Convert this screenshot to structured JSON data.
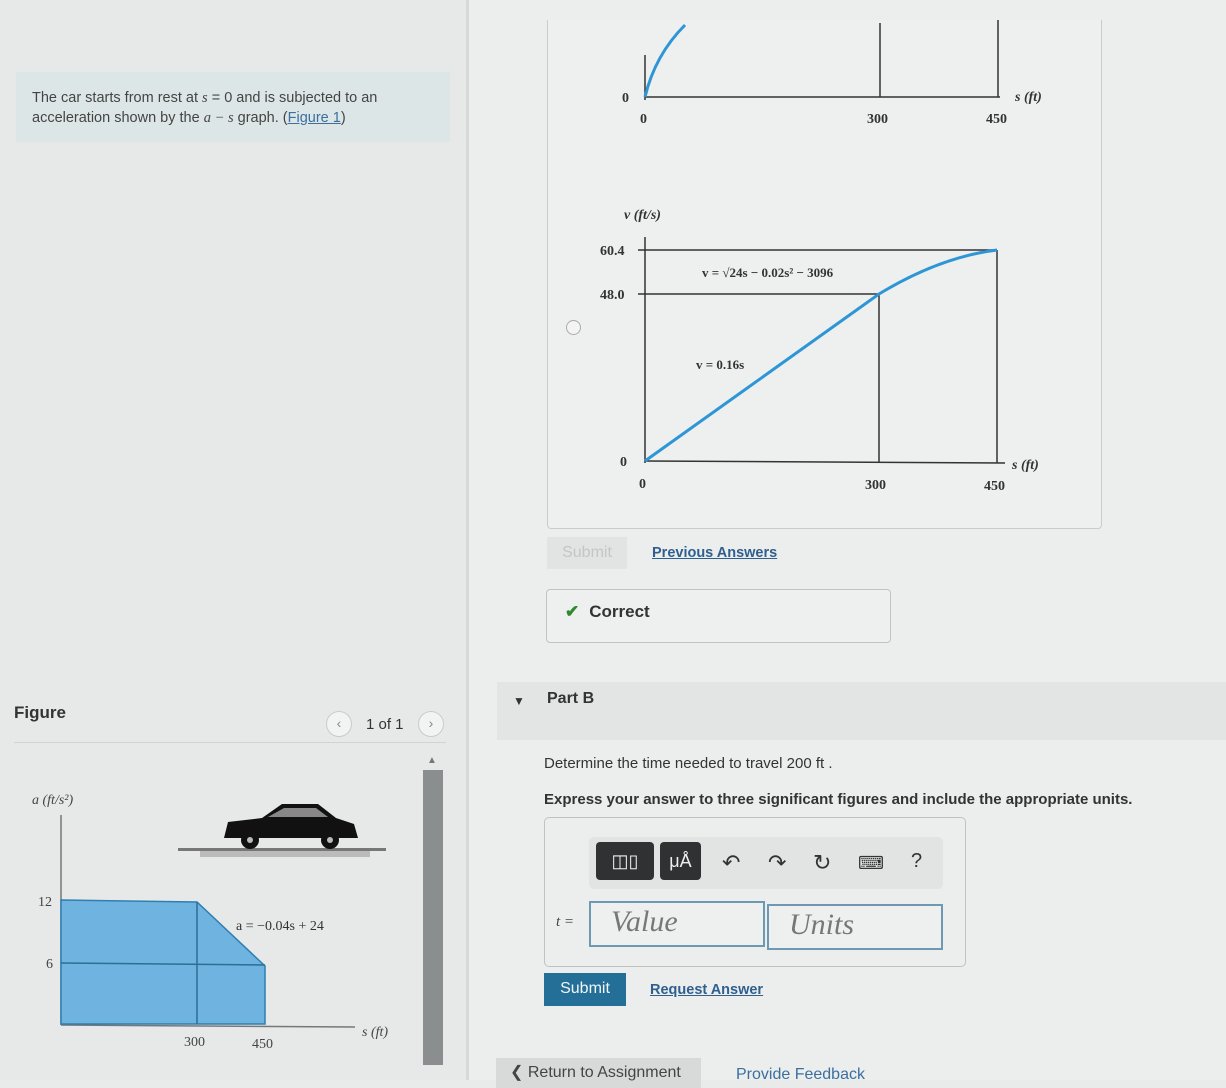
{
  "problem": {
    "text_before": "The car starts from rest at ",
    "var_s": "s",
    "eq_zero": " = 0",
    "text_mid": " and is subjected to an acceleration shown by the ",
    "graph_name": "a − s",
    "text_after": " graph. (",
    "figure_link": "Figure 1",
    "close": ")"
  },
  "figure_panel": {
    "title": "Figure",
    "prev_icon": "chevron-left",
    "next_icon": "chevron-right",
    "pager": "1 of 1",
    "graph": {
      "y_label": "a (ft/s²)",
      "x_label": "s (ft)",
      "y_ticks": [
        "12",
        "6"
      ],
      "x_ticks": [
        "300",
        "450"
      ],
      "equation": "a = −0.04s + 24",
      "fill_color": "#6fb3e0"
    }
  },
  "part_a": {
    "top_graph": {
      "y_tick": "0",
      "x_ticks": [
        "0",
        "300",
        "450"
      ],
      "x_label": "s (ft)"
    },
    "v_graph": {
      "y_label": "v (ft/s)",
      "y_ticks": [
        "60.4",
        "48.0",
        "0"
      ],
      "x_ticks": [
        "0",
        "300",
        "450"
      ],
      "x_label": "s (ft)",
      "eq_upper": "v = √24s − 0.02s² − 3096",
      "eq_lower": "v = 0.16s",
      "curve_color": "#2f96d6"
    },
    "submit_label": "Submit",
    "previous_answers": "Previous Answers",
    "status": "Correct",
    "status_icon": "check"
  },
  "part_b": {
    "title": "Part B",
    "question": "Determine the time needed to travel 200  ft .",
    "instruction": "Express your answer to three significant figures and include the appropriate units.",
    "toolbar": {
      "templates": "templates-icon",
      "units": "μÅ",
      "undo": "↶",
      "redo": "↷",
      "reset": "↻",
      "keyboard": "keyboard-icon",
      "help": "?"
    },
    "var_label": "t =",
    "value_placeholder": "Value",
    "units_placeholder": "Units",
    "submit_label": "Submit",
    "request_answer": "Request Answer"
  },
  "footer": {
    "return": "Return to Assignment",
    "feedback": "Provide Feedback"
  }
}
